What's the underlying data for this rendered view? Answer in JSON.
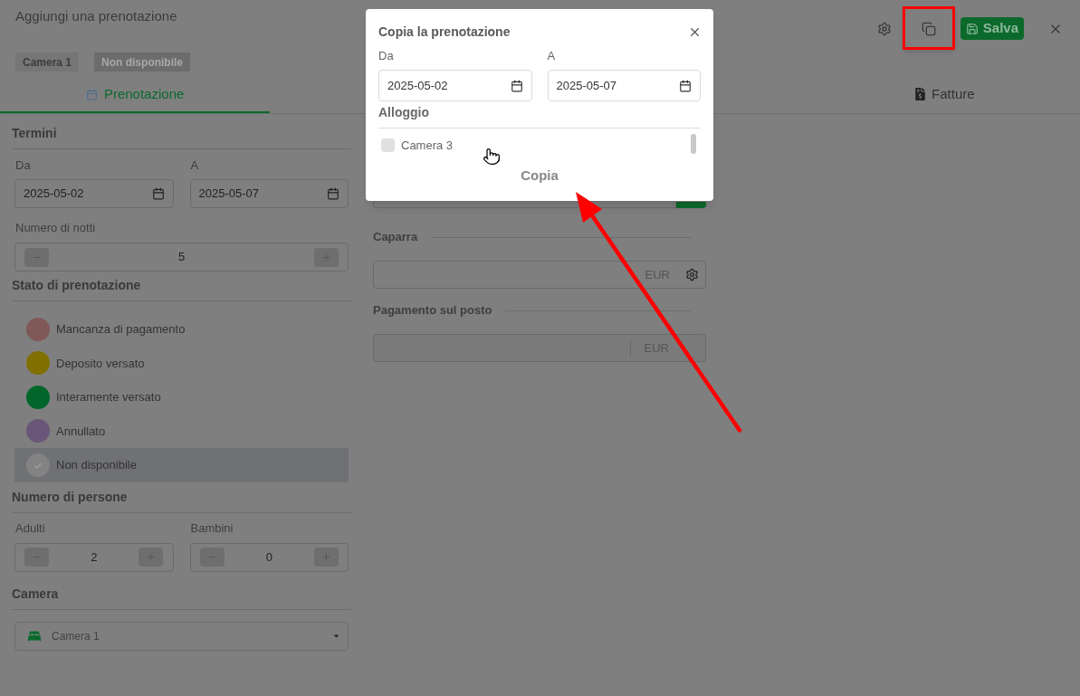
{
  "header": {
    "title": "Aggiungi una prenotazione",
    "save_label": "Salva"
  },
  "tags": [
    {
      "label": "Camera 1",
      "kind": "room"
    },
    {
      "label": "Non disponibile",
      "kind": "status"
    }
  ],
  "tabs": [
    {
      "label": "Prenotazione",
      "selected": true
    },
    {
      "label": "Fatture",
      "selected": false
    }
  ],
  "terms": {
    "title": "Termini",
    "dates": [
      {
        "label": "Da",
        "value": "2025-05-02"
      },
      {
        "label": "A",
        "value": "2025-05-07"
      }
    ],
    "nights_label": "Numero di notti",
    "nights": "5"
  },
  "status": {
    "title": "Stato di prenotazione",
    "items": [
      {
        "label": "Mancanza di pagamento",
        "color": "#805858",
        "selected": false
      },
      {
        "label": "Deposito versato",
        "color": "#807000",
        "selected": false
      },
      {
        "label": "Interamente versato",
        "color": "#00662a",
        "selected": false
      },
      {
        "label": "Annullato",
        "color": "#6a5678",
        "selected": false
      },
      {
        "label": "Non disponibile",
        "color": "#838383",
        "selected": true
      }
    ]
  },
  "people": {
    "title": "Numero di persone",
    "fields": [
      {
        "label": "Adulti",
        "value": "2"
      },
      {
        "label": "Bambini",
        "value": "0"
      }
    ]
  },
  "room": {
    "title": "Camera",
    "value": "Camera 1"
  },
  "payments": [
    {
      "title": "Caparra",
      "currency": "EUR",
      "disabled": false
    },
    {
      "title": "Pagamento sul posto",
      "currency": "EUR",
      "disabled": true
    }
  ],
  "copy_dialog": {
    "title": "Copia la prenotazione",
    "dates": [
      {
        "label": "Da",
        "value": "2025-05-02"
      },
      {
        "label": "A",
        "value": "2025-05-07"
      }
    ],
    "section": "Alloggio",
    "rooms": [
      {
        "label": "Camera 3",
        "checked": false
      }
    ],
    "button": "Copia"
  }
}
